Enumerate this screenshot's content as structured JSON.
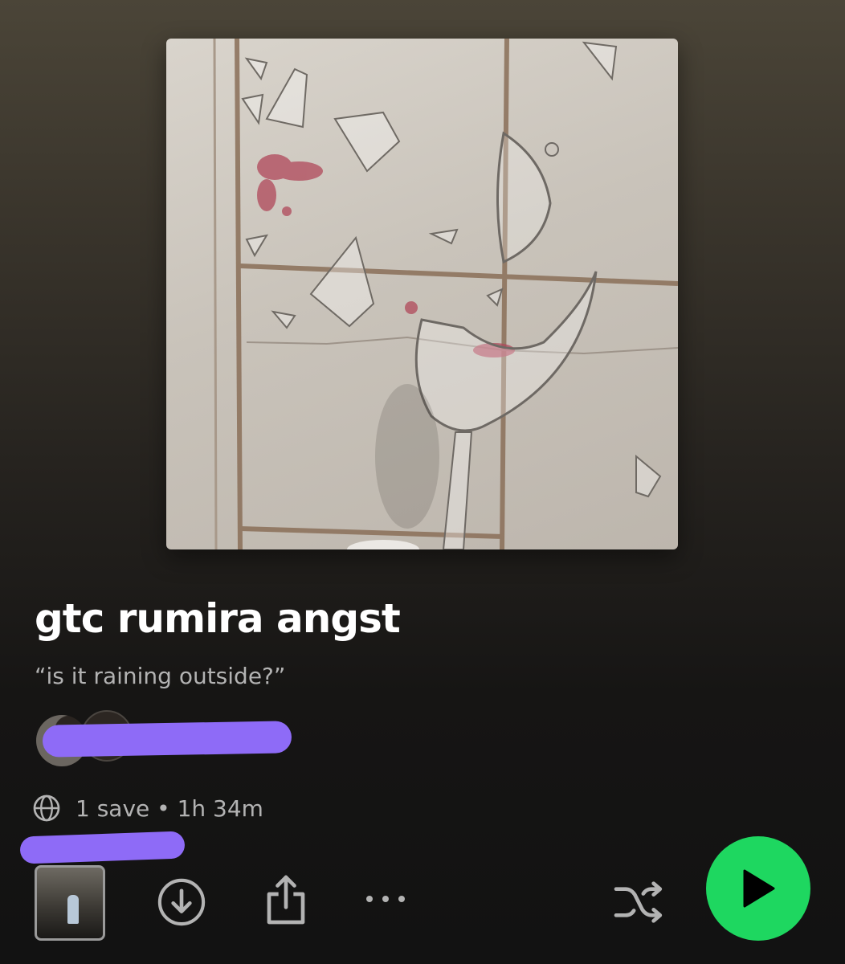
{
  "playlist": {
    "title": "gtc rumira angst",
    "description": "“is it raining outside?”",
    "cover_alt": "shattered wine glass against white tiles",
    "owner_name_redacted": true
  },
  "meta": {
    "visibility_icon": "globe-icon",
    "saves": "1 save",
    "separator": " • ",
    "duration": "1h 34m"
  },
  "actions": {
    "preview_icon": "playlist-preview-thumbnail",
    "download_icon": "download-icon",
    "share_icon": "share-icon",
    "more_icon": "more-options-icon",
    "shuffle_icon": "shuffle-icon",
    "play_icon": "play-icon"
  },
  "colors": {
    "accent": "#1ed760",
    "redaction": "#8e6bf7",
    "secondary_text": "#b3b3b3"
  }
}
